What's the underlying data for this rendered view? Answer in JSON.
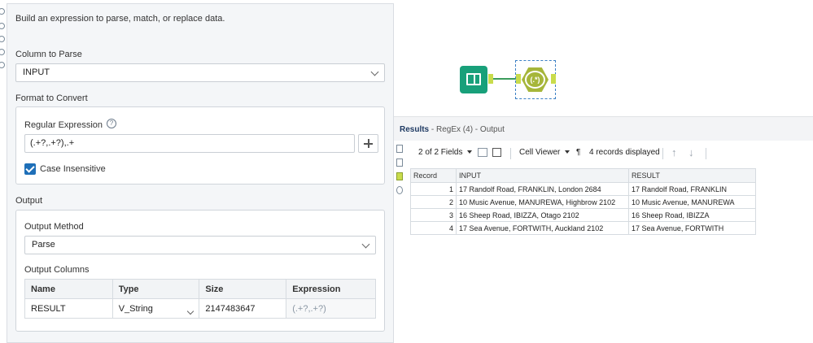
{
  "config": {
    "description": "Build an expression to parse, match, or replace data.",
    "column_to_parse": {
      "title": "Column to Parse",
      "value": "INPUT"
    },
    "format_to_convert": {
      "title": "Format to Convert",
      "regex_label": "Regular Expression",
      "help_icon": "?",
      "regex_value": "(.+?,.+?),.+",
      "case_insensitive_label": "Case Insensitive",
      "case_insensitive_checked": true
    },
    "output": {
      "title": "Output",
      "method_label": "Output Method",
      "method_value": "Parse",
      "columns_label": "Output Columns",
      "headers": [
        "Name",
        "Type",
        "Size",
        "Expression"
      ],
      "rows": [
        {
          "name": "RESULT",
          "type": "V_String",
          "size": "2147483647",
          "expression": "(.+?,.+?)"
        }
      ]
    }
  },
  "canvas": {
    "input_tool_icon": "book-icon",
    "regex_tool_icon": "regex-icon",
    "regex_symbol": "(.*)",
    "connection_color": "#3c9c5c"
  },
  "results": {
    "header_bold": "Results",
    "header_rest": " - RegEx (4) - Output",
    "toolbar": {
      "fields": "2 of 2 Fields",
      "viewer": "Cell Viewer",
      "pilcrow": "¶",
      "records": "4 records displayed"
    },
    "columns": [
      "Record",
      "INPUT",
      "RESULT"
    ],
    "rows": [
      {
        "record": "1",
        "input": "17 Randolf Road, FRANKLIN, London 2684",
        "result": "17 Randolf Road, FRANKLIN"
      },
      {
        "record": "2",
        "input": "10 Music Avenue, MANUREWA, Highbrow 2102",
        "result": "10 Music Avenue, MANUREWA"
      },
      {
        "record": "3",
        "input": "16 Sheep Road, IBIZZA, Otago 2102",
        "result": "16 Sheep Road, IBIZZA"
      },
      {
        "record": "4",
        "input": "17 Sea Avenue, FORTWITH, Auckland 2102",
        "result": "17 Sea Avenue, FORTWITH"
      }
    ]
  },
  "colors": {
    "accent": "#1e6fb8",
    "tool_green": "#18a07a",
    "regex_tool": "#a6b63a",
    "anchor": "#c9dc4c"
  }
}
